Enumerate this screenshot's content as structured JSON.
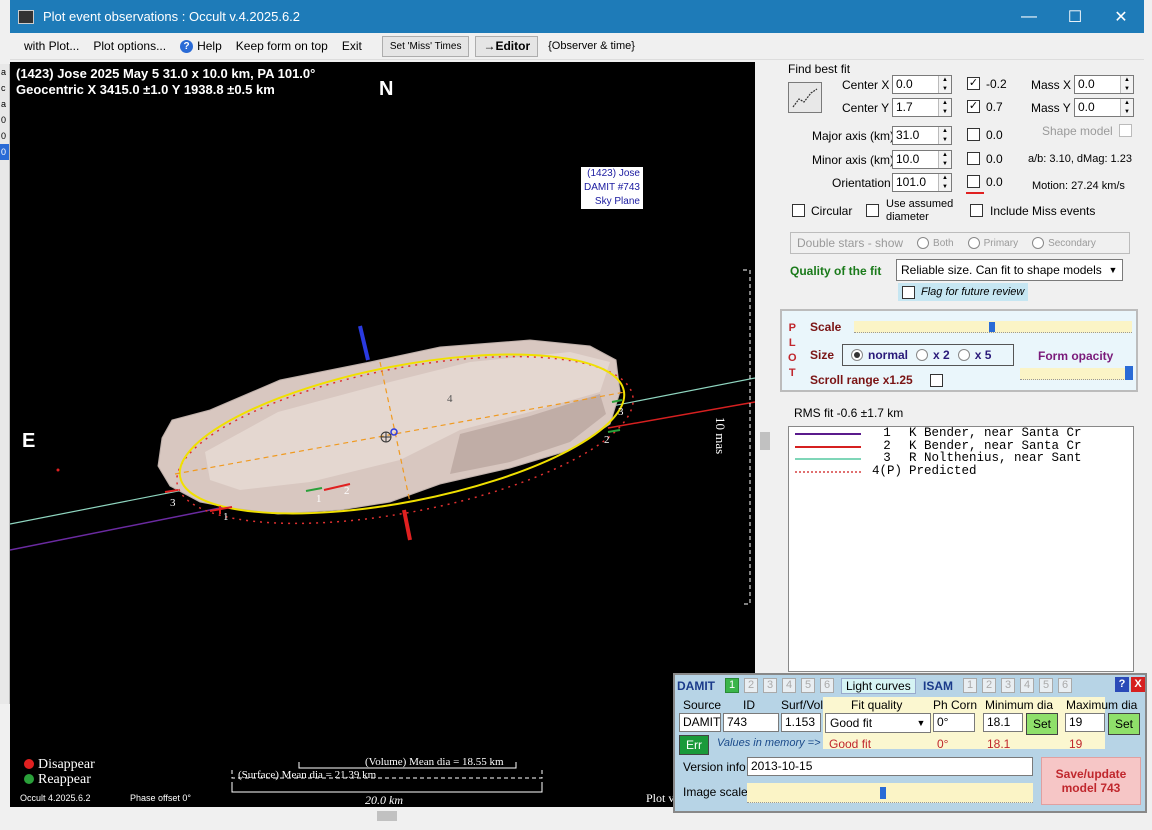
{
  "window": {
    "title": "Plot event observations : Occult v.4.2025.6.2",
    "minimize": "—",
    "maximize": "☐",
    "close": "✕"
  },
  "left_strip": [
    "a",
    "c",
    "a",
    "0",
    "0",
    "0"
  ],
  "menu": {
    "with_plot": "with Plot...",
    "plot_options": "Plot options...",
    "help": "Help",
    "keep_on_top": "Keep form on top",
    "exit": "Exit",
    "set_miss_times": "Set 'Miss' Times",
    "editor": "→Editor",
    "observer_time": "{Observer & time}"
  },
  "plot": {
    "header_line1": "(1423) Jose  2025 May 5  31.0 x 10.0 km, PA 101.0°",
    "header_line2": "Geocentric  X  3415.0 ±1.0  Y  1938.8 ±0.5 km",
    "north": "N",
    "east": "E",
    "damit_label": [
      "(1423) Jose",
      "DAMIT #743",
      "Sky Plane"
    ],
    "scale_label": "10 mas",
    "legend_disappear": "Disappear",
    "legend_reappear": "Reappear",
    "volume_dia": "(Volume) Mean dia = 18.55 km",
    "surface_dia": "(Surface) Mean dia = 21.39 km",
    "scalebar_km": "20.0 km",
    "version": "Occult 4.2025.6.2",
    "phase_offset": "Phase offset 0°",
    "plot_suffix": "Plot v",
    "chord_labels": [
      "1",
      "2",
      "3",
      "1",
      "2",
      "3",
      "4"
    ]
  },
  "fit": {
    "title": "Find best fit",
    "center_x_label": "Center X",
    "center_x": "0.0",
    "center_y_label": "Center Y",
    "center_y": "1.7",
    "center_x_cb": "-0.2",
    "center_y_cb": "0.7",
    "mass_x_label": "Mass X",
    "mass_x": "0.0",
    "mass_y_label": "Mass Y",
    "mass_y": "0.0",
    "shape_model_label": "Shape model",
    "major_label": "Major axis (km)",
    "major": "31.0",
    "major_cb": "0.0",
    "minor_label": "Minor axis (km)",
    "minor": "10.0",
    "minor_cb": "0.0",
    "orient_label": "Orientation",
    "orient": "101.0",
    "orient_cb": "0.0",
    "ab_dmag": "a/b: 3.10, dMag: 1.23",
    "motion": "Motion: 27.24 km/s",
    "circular": "Circular",
    "use_assumed": "Use assumed",
    "diameter": "diameter",
    "include_miss": "Include Miss events",
    "double_stars": "Double stars - show",
    "both": "Both",
    "primary": "Primary",
    "secondary": "Secondary",
    "quality_label": "Quality of the fit",
    "quality_value": "Reliable size. Can fit to shape models",
    "flag_review": "Flag for future review"
  },
  "plotgrp": {
    "letters": [
      "P",
      "L",
      "O",
      "T"
    ],
    "scale": "Scale",
    "size": "Size",
    "normal": "normal",
    "x2": "x 2",
    "x5": "x 5",
    "form_opacity": "Form opacity",
    "scroll_range": "Scroll range x1.25",
    "scale_level": 0.5,
    "opacity_level": 0.97
  },
  "rms": "RMS fit -0.6 ±1.7 km",
  "observers": [
    {
      "num": "1",
      "name": "K Bender, near Santa Cr",
      "color": "#5a1a8c",
      "style": "solid"
    },
    {
      "num": "2",
      "name": "K Bender, near Santa Cr",
      "color": "#d62020",
      "style": "solid"
    },
    {
      "num": "3",
      "name": "R Nolthenius, near Sant",
      "color": "#7fd6b8",
      "style": "solid"
    },
    {
      "num": "4(P)",
      "name": "Predicted",
      "color": "#e07070",
      "style": "dotted"
    }
  ],
  "damit_panel": {
    "damit": "DAMIT",
    "damit_tabs": [
      "1",
      "2",
      "3",
      "4",
      "5",
      "6"
    ],
    "light_curves": "Light curves",
    "isam": "ISAM",
    "isam_tabs": [
      "1",
      "2",
      "3",
      "4",
      "5",
      "6"
    ],
    "help": "?",
    "close": "X",
    "source_h": "Source",
    "id_h": "ID",
    "surfvol_h": "Surf/Vol",
    "fitq_h": "Fit quality",
    "phcorn_h": "Ph Corn",
    "mindia_h": "Minimum dia",
    "maxdia_h": "Maximum dia",
    "source": "DAMIT",
    "id": "743",
    "surfvol": "1.153",
    "fit_quality": "Good fit",
    "ph_corn": "0°",
    "min_dia": "18.1",
    "max_dia": "19",
    "set": "Set",
    "err": "Err",
    "values_memory": "Values in memory =>",
    "mem_fit": "Good fit",
    "mem_ph": "0°",
    "mem_min": "18.1",
    "mem_max": "19",
    "version_label": "Version info",
    "version_value": "2013-10-15",
    "image_scale": "Image scale",
    "save_line1": "Save/update",
    "save_line2": "model 743",
    "image_scale_level": 0.48
  }
}
